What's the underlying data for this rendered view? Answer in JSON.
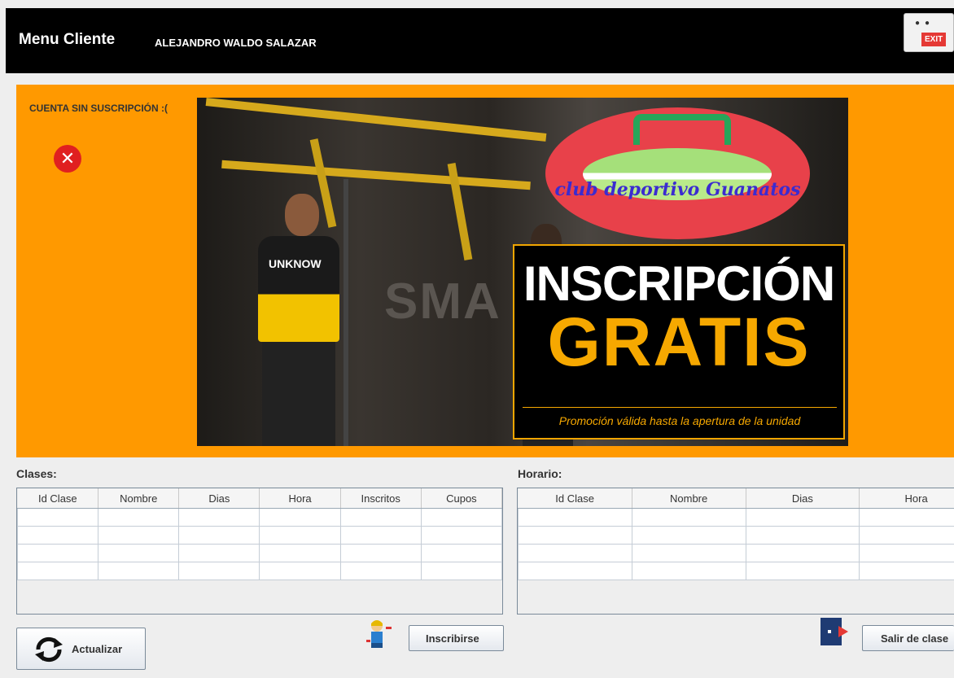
{
  "header": {
    "title": "Menu Cliente",
    "user_name": "ALEJANDRO WALDO SALAZAR",
    "exit_label": "EXIT"
  },
  "banner": {
    "status_text": "CUENTA SIN SUSCRIPCIÓN :(",
    "status_icon": "error-x-icon",
    "promo": {
      "logo_text": "club deportivo Guanatos",
      "shirt_text": "UNKNOW",
      "wall_text": "SMA",
      "headline_1": "INSCRIPCIÓN",
      "headline_2": "GRATIS",
      "note": "Promoción válida hasta la apertura de la unidad"
    }
  },
  "clases": {
    "label": "Clases:",
    "columns": [
      "Id Clase",
      "Nombre",
      "Dias",
      "Hora",
      "Inscritos",
      "Cupos"
    ],
    "empty_rows": 4
  },
  "horario": {
    "label": "Horario:",
    "columns": [
      "Id Clase",
      "Nombre",
      "Dias",
      "Hora"
    ],
    "empty_rows": 4
  },
  "buttons": {
    "refresh": "Actualizar",
    "enroll": "Inscribirse",
    "leave": "Salir de clase"
  },
  "colors": {
    "header_bg": "#000000",
    "banner_bg": "#ff9900",
    "accent_yellow": "#f6a800",
    "error_red": "#e02020"
  }
}
